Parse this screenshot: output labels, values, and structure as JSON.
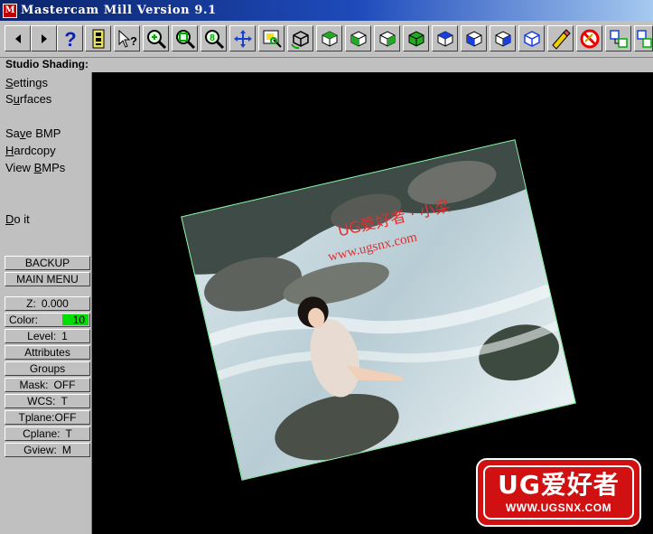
{
  "window": {
    "title": "Mastercam Mill Version 9.1"
  },
  "toolbar": {
    "buttons": [
      {
        "icon": "arrow-left-icon"
      },
      {
        "icon": "arrow-right-icon"
      },
      {
        "icon": "help-icon"
      },
      {
        "icon": "toolbar-toggle-icon"
      },
      {
        "icon": "analyze-pointer-icon"
      },
      {
        "icon": "zoom-in-icon"
      },
      {
        "icon": "zoom-fit-icon"
      },
      {
        "icon": "zoom-half-icon"
      },
      {
        "icon": "pan-icon"
      },
      {
        "icon": "zoom-window-icon"
      },
      {
        "icon": "rotate-view-icon"
      },
      {
        "icon": "top-view-icon"
      },
      {
        "icon": "front-view-icon"
      },
      {
        "icon": "side-view-icon"
      },
      {
        "icon": "iso-view-icon"
      },
      {
        "icon": "cplane-top-icon"
      },
      {
        "icon": "cplane-front-icon"
      },
      {
        "icon": "cplane-side-icon"
      },
      {
        "icon": "cplane-3d-icon"
      },
      {
        "icon": "screen-clear-colors-icon"
      },
      {
        "icon": "delete-icon"
      },
      {
        "icon": "move-entities-icon"
      },
      {
        "icon": "copy-entities-icon"
      }
    ]
  },
  "prompt": {
    "text": "Studio Shading:"
  },
  "menu": {
    "items": [
      {
        "label": "Settings",
        "hotkey": "S",
        "rest": "ettings"
      },
      {
        "label": "Surfaces",
        "prefix": "S",
        "hotkey": "u",
        "rest": "rfaces"
      },
      {
        "label": "Save BMP",
        "prefix": "Sa",
        "hotkey": "v",
        "rest": "e BMP"
      },
      {
        "label": "Hardcopy",
        "hotkey": "H",
        "rest": "ardcopy"
      },
      {
        "label": "View BMPs",
        "prefix": "View ",
        "hotkey": "B",
        "rest": "MPs"
      },
      {
        "label": "Do it",
        "hotkey": "D",
        "rest": "o it"
      }
    ],
    "backup": "BACKUP",
    "main_menu": "MAIN MENU"
  },
  "status": {
    "z_label": "Z:",
    "z_value": "0.000",
    "color_label": "Color:",
    "color_value": "10",
    "level_label": "Level:",
    "level_value": "1",
    "attributes": "Attributes",
    "groups": "Groups",
    "mask_label": "Mask:",
    "mask_value": "OFF",
    "wcs_label": "WCS:",
    "wcs_value": "T",
    "tplane_label": "Tplane:",
    "tplane_value": "OFF",
    "cplane_label": "Cplane:",
    "cplane_value": "T",
    "gview_label": "Gview:",
    "gview_value": "M"
  },
  "image": {
    "overlay_line1": "UG爱好者 · 小梁",
    "overlay_line2": "www.ugsnx.com"
  },
  "watermark": {
    "line1": "UG爱好者",
    "line2": "WWW.UGSNX.COM"
  },
  "colors": {
    "title_bar": "#0a246a",
    "face": "#c0c0c0",
    "graphics_bg": "#000000",
    "color_swatch": "#00e000",
    "watermark_red": "#d11111"
  }
}
